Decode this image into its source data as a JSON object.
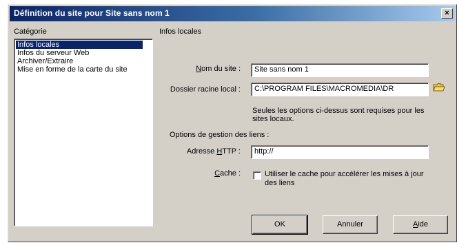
{
  "window": {
    "title": "Définition du site pour  Site sans nom 1",
    "close_glyph": "×"
  },
  "category": {
    "heading": "Catégorie",
    "items": [
      {
        "label": "Infos locales",
        "selected": true
      },
      {
        "label": "Infos du serveur Web",
        "selected": false
      },
      {
        "label": "Archiver/Extraire",
        "selected": false
      },
      {
        "label": "Mise en forme de la carte du site",
        "selected": false
      }
    ]
  },
  "panel": {
    "title": "Infos locales",
    "site_name": {
      "label_pre": "",
      "label_mnemonic": "N",
      "label_post": "om du site :",
      "value": "Site sans nom 1"
    },
    "root_folder": {
      "label": "Dossier racine local :",
      "value": "C:\\PROGRAM FILES\\MACROMEDIA\\DR",
      "icon": "folder-icon"
    },
    "note": "Seules les options ci-dessus sont requises pour les sites locaux.",
    "link_management_heading": "Options de gestion des liens :",
    "http_address": {
      "label_pre": "Adresse ",
      "label_mnemonic": "H",
      "label_post": "TTP :",
      "value": "http://"
    },
    "cache": {
      "label_pre": "",
      "label_mnemonic": "C",
      "label_post": "ache :",
      "checked": false,
      "description": "Utiliser le cache pour accélérer les mises à jour des liens"
    }
  },
  "buttons": {
    "ok": "OK",
    "cancel": "Annuler",
    "help_mnemonic": "A",
    "help_rest": "ide"
  },
  "colors": {
    "dialog_face": "#d4d0c8",
    "titlebar_start": "#0a246a",
    "titlebar_end": "#a6caf0",
    "selection": "#0a246a",
    "folder_icon": "#e8c840"
  }
}
